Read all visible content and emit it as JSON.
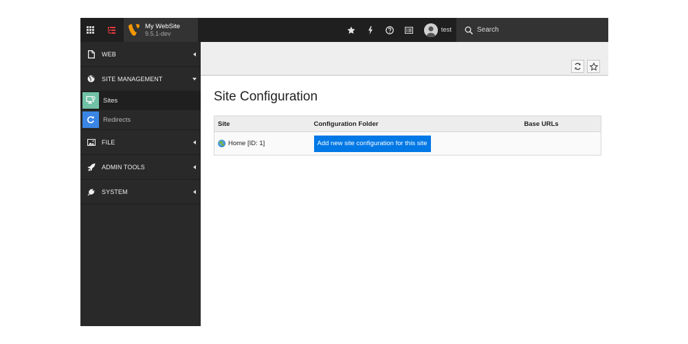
{
  "topbar": {
    "site_name": "My WebSite",
    "version": "9.5.1-dev",
    "user": "test",
    "search_label": "Search",
    "icons": [
      "apps-icon",
      "pagetree-icon",
      "typo3-logo-icon",
      "star-icon",
      "bolt-icon",
      "help-icon",
      "system-info-icon",
      "user-avatar-icon",
      "search-icon"
    ],
    "logo_color": "#f49700",
    "tree_icon_color": "#e8393f"
  },
  "sidebar": {
    "groups": [
      {
        "label": "WEB",
        "icon": "file-icon",
        "expanded": false
      },
      {
        "label": "SITE MANAGEMENT",
        "icon": "globe-icon",
        "expanded": true,
        "items": [
          {
            "label": "Sites",
            "icon": "sites-icon",
            "color": "#71c1a5",
            "active": true
          },
          {
            "label": "Redirects",
            "icon": "redirect-icon",
            "color": "#3a85e5",
            "active": false
          }
        ]
      },
      {
        "label": "FILE",
        "icon": "image-icon",
        "expanded": false
      },
      {
        "label": "ADMIN TOOLS",
        "icon": "rocket-icon",
        "expanded": false
      },
      {
        "label": "SYSTEM",
        "icon": "plug-icon",
        "expanded": false
      }
    ]
  },
  "content": {
    "title": "Site Configuration",
    "table": {
      "headers": [
        "Site",
        "Configuration Folder",
        "Base URLs"
      ],
      "rows": [
        {
          "site": "Home [ID: 1]",
          "action_label": "Add new site configuration for this site",
          "base_urls": ""
        }
      ]
    },
    "docheader_icons": [
      "refresh-icon",
      "bookmark-star-icon"
    ]
  }
}
